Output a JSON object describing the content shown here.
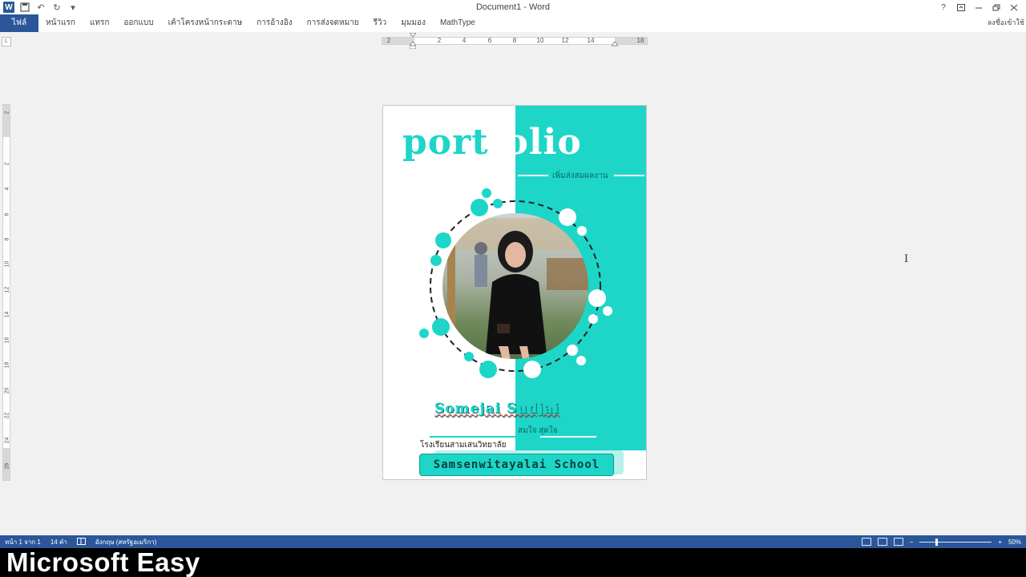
{
  "window": {
    "title": "Document1 - Word",
    "signin_label": "ลงชื่อเข้าใช้"
  },
  "qat": {
    "undo_label": "↶",
    "redo_label": "↻",
    "more_label": "▾"
  },
  "ribbon": {
    "tabs": [
      {
        "label": "ไฟล์"
      },
      {
        "label": "หน้าแรก"
      },
      {
        "label": "แทรก"
      },
      {
        "label": "ออกแบบ"
      },
      {
        "label": "เค้าโครงหน้ากระดาษ"
      },
      {
        "label": "การอ้างอิง"
      },
      {
        "label": "การส่งจดหมาย"
      },
      {
        "label": "รีวิว"
      },
      {
        "label": "มุมมอง"
      },
      {
        "label": "MathType"
      }
    ]
  },
  "ruler": {
    "corner_label": "L",
    "h_numbers": [
      "2",
      "2",
      "4",
      "6",
      "8",
      "10",
      "12",
      "14",
      "18"
    ],
    "v_numbers": [
      "2",
      "2",
      "4",
      "6",
      "8",
      "10",
      "12",
      "14",
      "16",
      "18",
      "20",
      "22",
      "24",
      "26"
    ]
  },
  "document": {
    "title_part1": "port",
    "title_part2": "folio",
    "subtitle": "เพิ่มส่งสมผลงาน",
    "name_en": "Somejai Sudjai",
    "name_th": "สมใจ สุดใจ",
    "school_th": "โรงเรียนสามเสนวิทยาลัย",
    "school_en": "Samsenwitayalai School"
  },
  "statusbar": {
    "page_info": "หน้า 1 จาก 1",
    "word_count": "14 คำ",
    "language": "อังกฤษ (สหรัฐอเมริกา)",
    "zoom": "50%"
  },
  "caption": {
    "text": "Microsoft Easy"
  },
  "colors": {
    "word_blue": "#2b579a",
    "teal": "#1dd6c8",
    "dark_teal": "#0a6b63"
  }
}
